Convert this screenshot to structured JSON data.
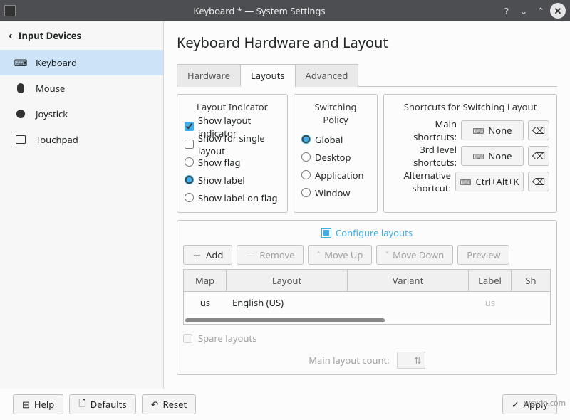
{
  "window": {
    "title": "Keyboard * — System Settings"
  },
  "sidebar": {
    "back": "Input Devices",
    "items": [
      {
        "label": "Keyboard",
        "selected": true
      },
      {
        "label": "Mouse"
      },
      {
        "label": "Joystick"
      },
      {
        "label": "Touchpad"
      }
    ]
  },
  "page_title": "Keyboard Hardware and Layout",
  "tabs": {
    "items": [
      "Hardware",
      "Layouts",
      "Advanced"
    ],
    "active": "Layouts"
  },
  "layout_indicator": {
    "title": "Layout Indicator",
    "show_layout_indicator": {
      "label": "Show layout indicator",
      "checked": true
    },
    "show_for_single": {
      "label": "Show for single layout",
      "checked": false
    },
    "show_flag": {
      "label": "Show flag",
      "checked": false
    },
    "show_label": {
      "label": "Show label",
      "checked": true
    },
    "show_label_on_flag": {
      "label": "Show label on flag",
      "checked": false
    }
  },
  "switching_policy": {
    "title": "Switching Policy",
    "selected": "Global",
    "options": [
      "Global",
      "Desktop",
      "Application",
      "Window"
    ]
  },
  "shortcuts": {
    "title": "Shortcuts for Switching Layout",
    "main": {
      "label": "Main shortcuts:",
      "value": "None"
    },
    "third": {
      "label": "3rd level shortcuts:",
      "value": "None"
    },
    "alt": {
      "label": "Alternative shortcut:",
      "value": "Ctrl+Alt+K"
    }
  },
  "configure": {
    "label": "Configure layouts",
    "checked": true,
    "buttons": {
      "add": "Add",
      "remove": "Remove",
      "move_up": "Move Up",
      "move_down": "Move Down",
      "preview": "Preview"
    },
    "columns": {
      "map": "Map",
      "layout": "Layout",
      "variant": "Variant",
      "label": "Label",
      "shortcut": "Shortcut"
    },
    "rows": [
      {
        "map": "us",
        "layout": "English (US)",
        "variant": "",
        "label": "us",
        "shortcut": ""
      }
    ],
    "spare": {
      "label": "Spare layouts",
      "checked": false
    },
    "main_layout_count": {
      "label": "Main layout count:",
      "value": ""
    }
  },
  "footer": {
    "help": "Help",
    "defaults": "Defaults",
    "reset": "Reset",
    "apply": "Apply"
  },
  "watermark": "wsxdn.com"
}
